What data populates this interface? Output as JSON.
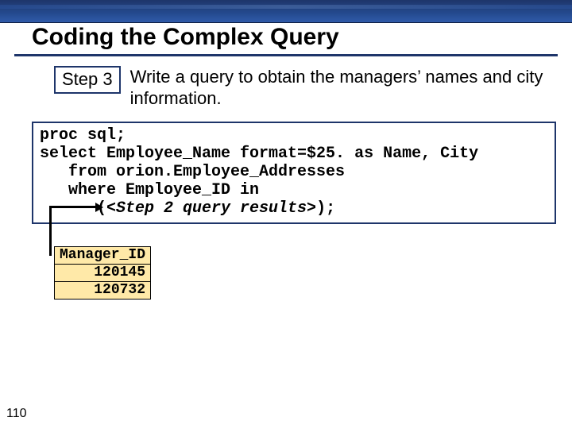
{
  "title": "Coding the Complex Query",
  "step": {
    "label": "Step 3",
    "text": "Write a query to obtain the managers’ names and city information."
  },
  "code": {
    "l1": "proc sql;",
    "l2": "select Employee_Name format=$25. as Name, City",
    "l3": "   from orion.Employee_Addresses",
    "l4": "   where Employee_ID in",
    "l5a": "      (",
    "l5b": "<Step 2 query results>",
    "l5c": ");"
  },
  "table": {
    "header": "Manager_ID",
    "rows": [
      "120145",
      "120732"
    ]
  },
  "page_number": "110"
}
